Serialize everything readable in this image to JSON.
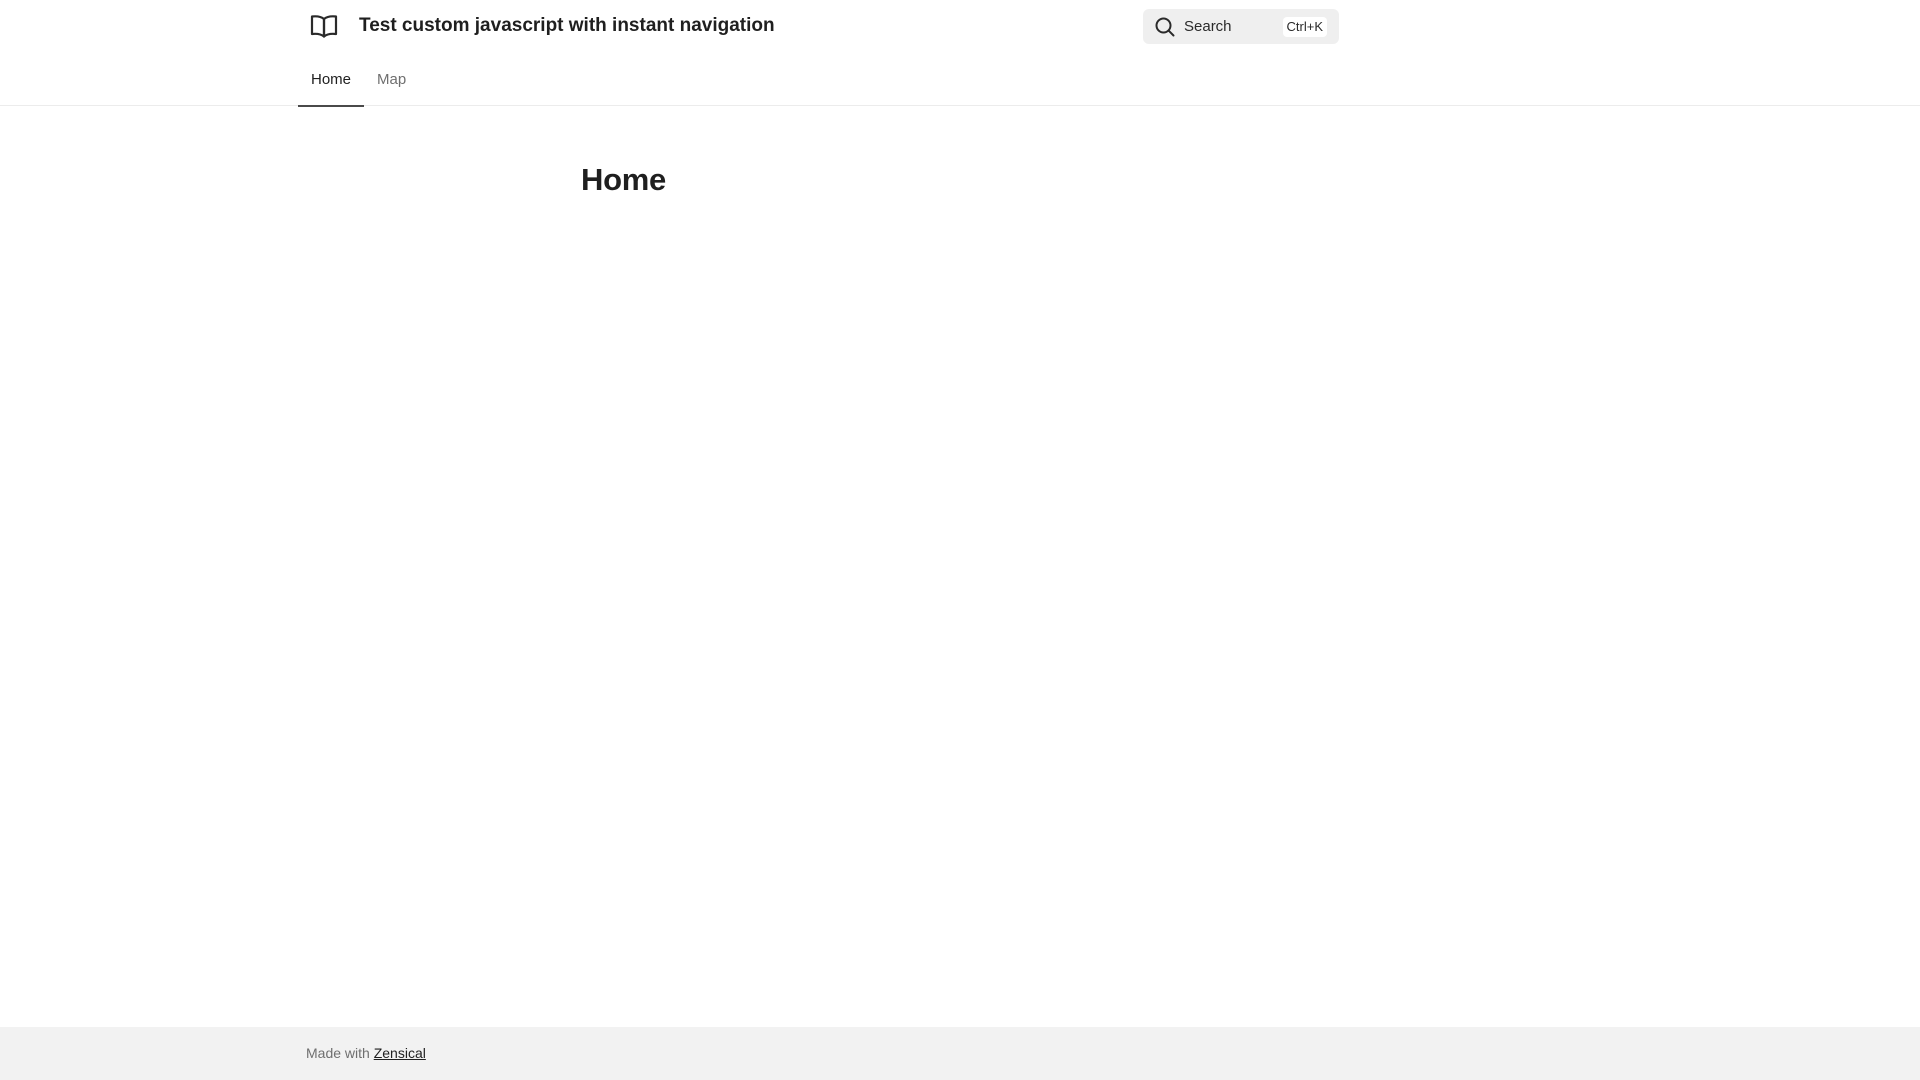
{
  "header": {
    "logo_icon": "book-open-icon",
    "site_title": "Test custom javascript with instant navigation",
    "search": {
      "icon": "search-icon",
      "label": "Search",
      "shortcut": "Ctrl+K"
    }
  },
  "tabs": [
    {
      "label": "Home",
      "active": true
    },
    {
      "label": "Map",
      "active": false
    }
  ],
  "main": {
    "title": "Home"
  },
  "footer": {
    "prefix": "Made with",
    "link_label": "Zensical"
  },
  "colors": {
    "text": "#1f1f1f",
    "muted": "#6f6f6f",
    "search_bg": "#efefef",
    "footer_bg": "#f2f2f2"
  }
}
